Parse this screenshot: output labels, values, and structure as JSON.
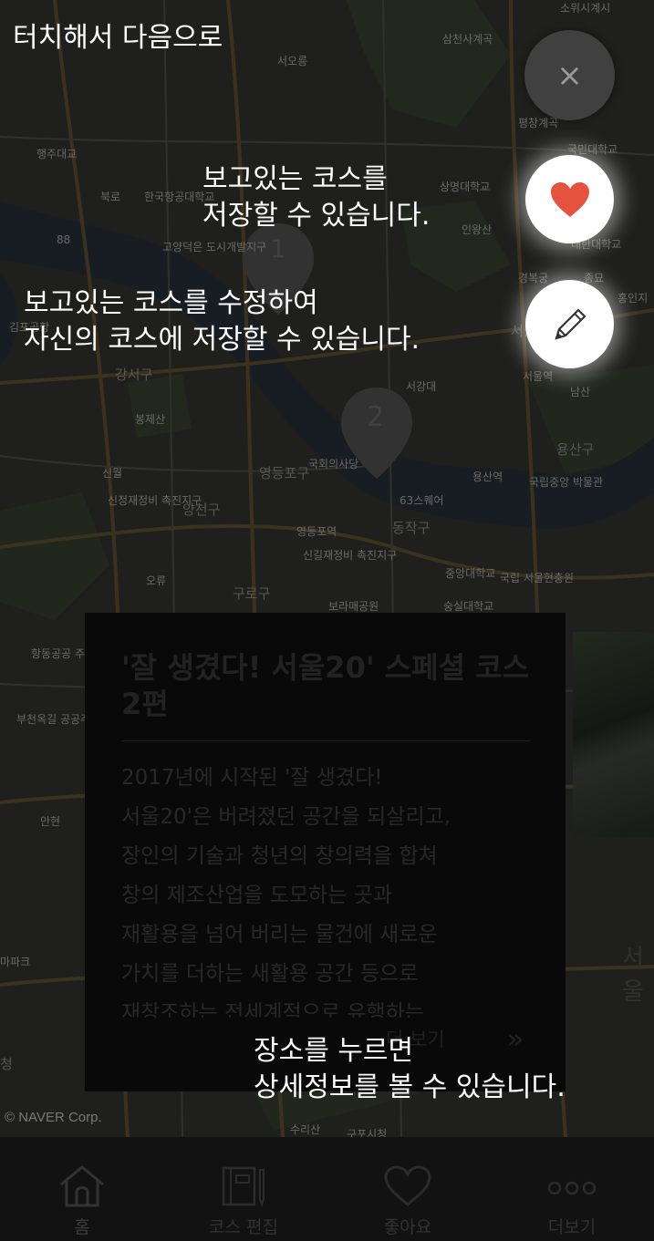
{
  "map": {
    "labels": [
      "소위시계시",
      "삼천사계곡",
      "서오릉",
      "평창계곡",
      "국민대학교",
      "상명대학교",
      "한국항공대학교",
      "인왕산",
      "고양덕은 도시개발지구",
      "대한대학교",
      "경복궁",
      "종묘",
      "홍인지",
      "서울",
      "서울역",
      "남산",
      "서강대",
      "강서구",
      "봉제산",
      "영등포구",
      "국회의사당",
      "용산구",
      "용산역",
      "국립중앙 박물관",
      "63스퀘어",
      "영등포역",
      "동작구",
      "신정재정비 촉진지구",
      "신길재정비 촉진지구",
      "중앙대학교",
      "국립 서울현충원",
      "구로구",
      "보라매공원",
      "숭실대학교",
      "항동공공 주택지구",
      "부천옥길 공공주택지구",
      "마파크",
      "수리산",
      "안현",
      "오류",
      "신월",
      "청",
      "구포시청",
      "북로",
      "행주대교",
      "88",
      "양천구",
      "김포공항"
    ],
    "markers": [
      "1",
      "2"
    ]
  },
  "card": {
    "title": "'잘 생겼다! 서울20' 스페셜 코스 2편",
    "desc_lines": [
      "2017년에 시작된 '잘 생겼다!",
      "서울20'은 버려졌던 공간을 되살리고,",
      "장인의 기술과 청년의 창의력을 합쳐",
      "창의 제조산업을 도모하는 곳과",
      "재활용을 넘어 버리는 물건에 새로운",
      "가치를 더하는 새활용 공간 등으로",
      "재창조하는 전세계적으로 유행하는"
    ],
    "more_label": "더 보기",
    "chevron": "»"
  },
  "side_label": "서울",
  "buttons": {
    "close_glyph": "×",
    "heart_icon": "heart-icon",
    "pencil_icon": "pencil-icon"
  },
  "hints": {
    "next": "터치해서 다음으로",
    "save_line1": "보고있는 코스를",
    "save_line2": "저장할 수 있습니다.",
    "edit_line1": "보고있는 코스를 수정하여",
    "edit_line2": "자신의 코스에 저장할 수 있습니다.",
    "place_line1": "장소를 누르면",
    "place_line2": "상세정보를 볼 수 있습니다."
  },
  "copyright": "© NAVER Corp.",
  "tabs": [
    {
      "label": "홈",
      "icon": "home-icon"
    },
    {
      "label": "코스 편집",
      "icon": "notebook-icon"
    },
    {
      "label": "좋아요",
      "icon": "heart-outline-icon"
    },
    {
      "label": "더보기",
      "icon": "more-icon"
    }
  ],
  "colors": {
    "accent_heart": "#e5533f",
    "hint_text": "#ffffff"
  }
}
